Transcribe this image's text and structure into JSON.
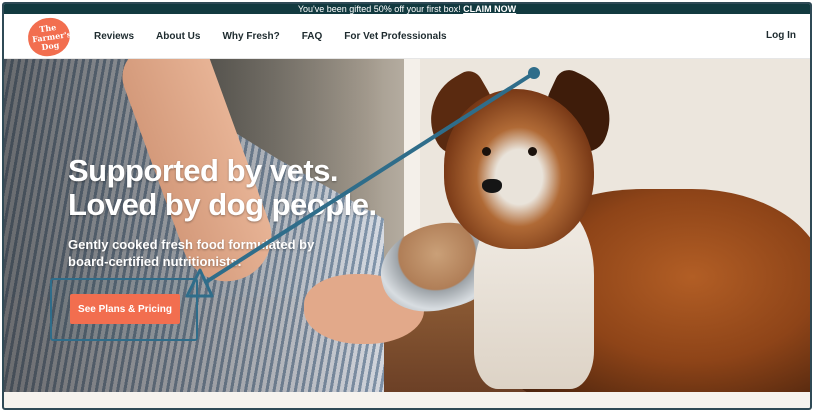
{
  "promo": {
    "text": "You've been gifted 50% off your first box! ",
    "link_label": "CLAIM NOW"
  },
  "brand": {
    "logo_text": "The Farmer's Dog",
    "accent_color": "#f26e4f"
  },
  "nav": {
    "items": [
      {
        "label": "Reviews"
      },
      {
        "label": "About Us"
      },
      {
        "label": "Why Fresh?"
      },
      {
        "label": "FAQ"
      },
      {
        "label": "For Vet Professionals"
      }
    ],
    "login_label": "Log In"
  },
  "hero": {
    "title_line1": "Supported by vets.",
    "title_line2": "Loved by dog people.",
    "subtitle_line1": "Gently cooked fresh food formulated by",
    "subtitle_line2": "board-certified nutritionists.",
    "cta_label": "See Plans & Pricing"
  },
  "annotation": {
    "color": "#2f6d8a",
    "icon": "arrow-pointer-icon"
  }
}
